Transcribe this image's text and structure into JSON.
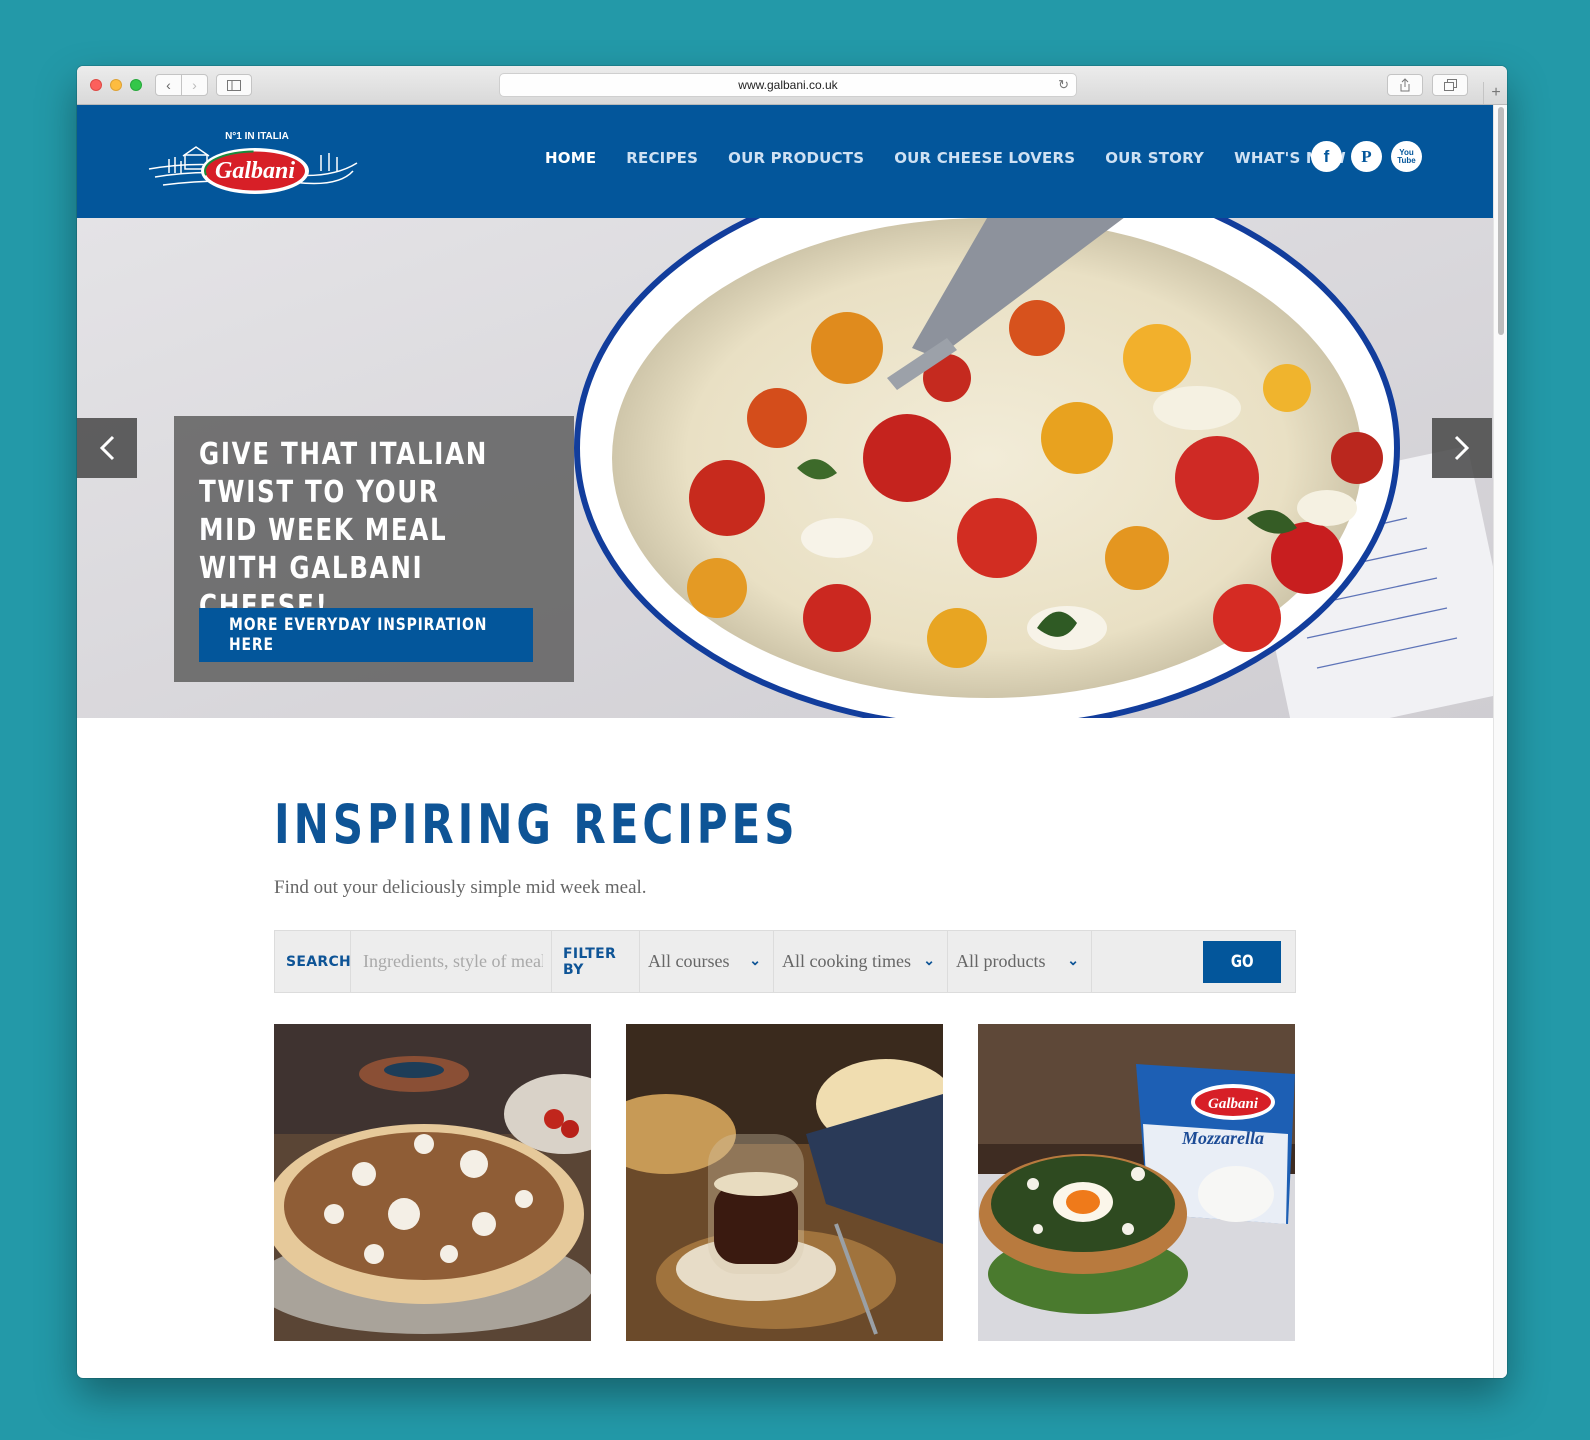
{
  "browser": {
    "url": "www.galbani.co.uk"
  },
  "header": {
    "logo_text": "Galbani",
    "logo_tagline": "N°1 IN ITALIA",
    "nav": [
      {
        "label": "HOME",
        "active": true
      },
      {
        "label": "RECIPES",
        "active": false
      },
      {
        "label": "OUR PRODUCTS",
        "active": false
      },
      {
        "label": "OUR CHEESE LOVERS",
        "active": false
      },
      {
        "label": "OUR STORY",
        "active": false
      },
      {
        "label": "WHAT'S NEW",
        "active": false
      }
    ],
    "social": [
      {
        "icon": "facebook-icon",
        "glyph": "f"
      },
      {
        "icon": "pinterest-icon",
        "glyph": "P"
      },
      {
        "icon": "youtube-icon",
        "glyph": "You\nTube"
      }
    ]
  },
  "hero": {
    "headline": "GIVE THAT ITALIAN TWIST TO YOUR MID WEEK MEAL WITH GALBANI CHEESE!",
    "cta_label": "MORE EVERYDAY INSPIRATION HERE"
  },
  "recipes": {
    "title": "INSPIRING RECIPES",
    "subtitle": "Find out your deliciously simple mid week meal.",
    "search_label": "SEARCH",
    "search_placeholder": "Ingredients, style of meal...",
    "filter_label": "FILTER BY",
    "filters": [
      {
        "name": "courses",
        "selected": "All courses"
      },
      {
        "name": "cooking-times",
        "selected": "All cooking times"
      },
      {
        "name": "products",
        "selected": "All products"
      }
    ],
    "go_label": "GO",
    "product_pack_text": "Mozzarella",
    "product_pack_brand": "Galbani"
  },
  "colors": {
    "brand_blue": "#03569b",
    "title_blue": "#0e5496",
    "background": "#2399a8"
  }
}
